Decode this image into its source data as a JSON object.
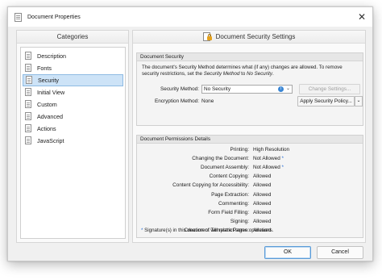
{
  "window": {
    "title": "Document Properties",
    "close_glyph": "✕"
  },
  "categories": {
    "header": "Categories",
    "items": [
      {
        "label": "Description",
        "icon": "description-icon"
      },
      {
        "label": "Fonts",
        "icon": "fonts-icon"
      },
      {
        "label": "Security",
        "icon": "security-icon",
        "selected": true
      },
      {
        "label": "Initial View",
        "icon": "initial-view-icon"
      },
      {
        "label": "Custom",
        "icon": "custom-icon"
      },
      {
        "label": "Advanced",
        "icon": "advanced-icon"
      },
      {
        "label": "Actions",
        "icon": "actions-icon"
      },
      {
        "label": "JavaScript",
        "icon": "javascript-icon"
      }
    ]
  },
  "main": {
    "header": "Document Security Settings",
    "security": {
      "section_title": "Document Security",
      "desc_line1": "The document's Security Method determines what (if any) changes are allowed. To remove",
      "desc_line2_prefix": "security restrictions, set the ",
      "desc_line2_italic1": "Security Method",
      "desc_line2_mid": " to ",
      "desc_line2_italic2": "No Security",
      "desc_line2_suffix": ".",
      "method_label": "Security Method:",
      "method_value": "No Security",
      "info_glyph": "i",
      "change_settings": "Change Settings...",
      "encryption_label": "Encryption Method:",
      "encryption_value": "None",
      "apply_policy": "Apply Security Policy...",
      "caret_glyph": "⌄"
    },
    "permissions": {
      "section_title": "Document Permissions Details",
      "rows": [
        {
          "key": "Printing:",
          "value": "High Resolution",
          "star": ""
        },
        {
          "key": "Changing the Document:",
          "value": "Not Allowed",
          "star": "*"
        },
        {
          "key": "Document Assembly:",
          "value": "Not Allowed",
          "star": "*"
        },
        {
          "key": "Content Copying:",
          "value": "Allowed",
          "star": ""
        },
        {
          "key": "Content Copying for Accessibility:",
          "value": "Allowed",
          "star": ""
        },
        {
          "key": "Page Extraction:",
          "value": "Allowed",
          "star": ""
        },
        {
          "key": "Commenting:",
          "value": "Allowed",
          "star": ""
        },
        {
          "key": "Form Field Filling:",
          "value": "Allowed",
          "star": ""
        },
        {
          "key": "Signing:",
          "value": "Allowed",
          "star": ""
        },
        {
          "key": "Creation of Template Pages:",
          "value": "Allowed",
          "star": ""
        }
      ],
      "note_star": "*",
      "note": " Signature(s) in this document will restrict some operations."
    }
  },
  "buttons": {
    "ok": "OK",
    "cancel": "Cancel"
  },
  "colors": {
    "selection": "#cde3f7",
    "accent": "#2a6fd4",
    "ok_border": "#5a9bd8"
  }
}
